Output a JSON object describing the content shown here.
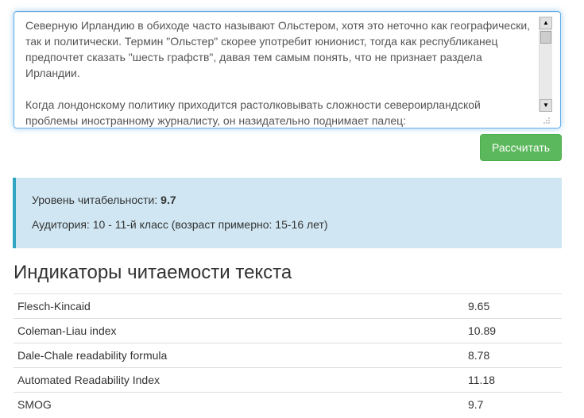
{
  "textarea": {
    "text": "Северную Ирландию в обиходе часто называют Ольстером, хотя это неточно как географически, так и политически. Термин \"Ольстер\" скорее употребит юнионист, тогда как республиканец предпочтет сказать \"шесть графств\", давая тем самым понять, что не признает раздела Ирландии.\n\nКогда лондонскому политику приходится растолковывать сложности североирландской проблемы иностранному журналисту, он назидательно поднимает палец:"
  },
  "button": {
    "label": "Рассчитать",
    "color": "#5cb85c"
  },
  "result": {
    "readability_label": "Уровень читабельности:",
    "readability_value": "9.7",
    "audience_text": "Аудитория: 10 - 11-й класс (возраст примерно: 15-16 лет)",
    "box_color": "#d0e7f3",
    "accent_color": "#31a5c1"
  },
  "section": {
    "title": "Индикаторы читаемости текста"
  },
  "indicators": [
    {
      "name": "Flesch-Kincaid",
      "value": "9.65"
    },
    {
      "name": "Coleman-Liau index",
      "value": "10.89"
    },
    {
      "name": "Dale-Chale readability formula",
      "value": "8.78"
    },
    {
      "name": "Automated Readability Index",
      "value": "11.18"
    },
    {
      "name": "SMOG",
      "value": "9.7"
    }
  ]
}
